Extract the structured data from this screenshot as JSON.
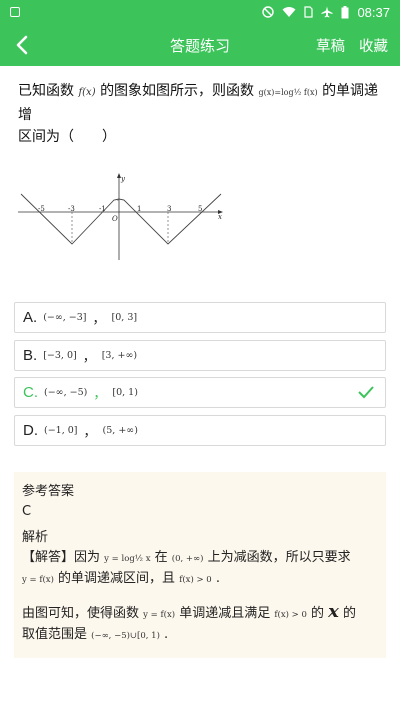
{
  "status_bar": {
    "time": "08:37"
  },
  "app_bar": {
    "title": "答题练习",
    "draft": "草稿",
    "favorite": "收藏"
  },
  "question": {
    "prefix": "已知函数",
    "f_expr": "f(x)",
    "middle": "的图象如图所示，则函数",
    "g_expr": "g(x)=log½ f(x)",
    "suffix": "的单调递增",
    "line2": "区间为（　　）"
  },
  "graph": {
    "y_label": "y",
    "x_label": "x",
    "origin": "O",
    "ticks": [
      "-5",
      "-3",
      "-1",
      "1",
      "3",
      "5"
    ]
  },
  "options": [
    {
      "letter": "A.",
      "expr1": "(−∞, −3]",
      "sep": "，",
      "expr2": "[0, 3]",
      "correct": false
    },
    {
      "letter": "B.",
      "expr1": "[−3, 0]",
      "sep": "，",
      "expr2": "[3, +∞)",
      "correct": false
    },
    {
      "letter": "C.",
      "expr1": "(−∞, −5)",
      "sep": "，",
      "expr2": "[0, 1)",
      "correct": true
    },
    {
      "letter": "D.",
      "expr1": "(−1, 0]",
      "sep": "，",
      "expr2": "(5, +∞)",
      "correct": false
    }
  ],
  "answer": {
    "ref_label": "参考答案",
    "ref_value": "C",
    "analysis_label": "解析",
    "line1_a": "【解答】因为",
    "line1_math": "y = log½ x",
    "line1_b": "在",
    "line1_math2": "(0, +∞)",
    "line1_c": "上为减函数，所以只要求",
    "line2_math": "y = f(x)",
    "line2_a": "的单调递减区间，且",
    "line2_math2": "f(x) > 0",
    "line2_b": ".",
    "line3_a": "由图可知，使得函数",
    "line3_math": "y = f(x)",
    "line3_b": "单调递减且满足",
    "line3_math2": "f(x) > 0",
    "line3_c": "的",
    "line3_x": "x",
    "line3_d": "的",
    "line4_a": "取值范围是",
    "line4_math": "(−∞, −5)∪[0, 1)",
    "line4_b": "."
  }
}
